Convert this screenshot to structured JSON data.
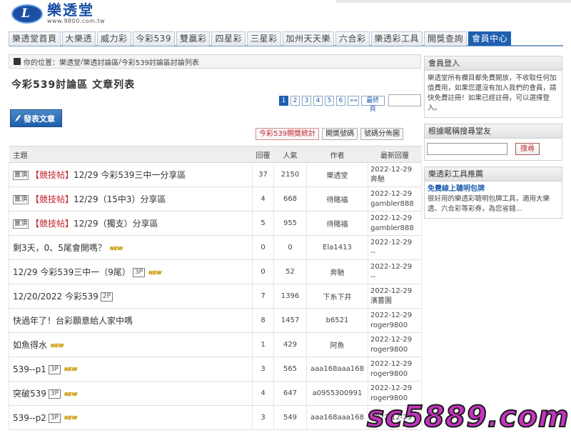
{
  "site": {
    "name": "樂透堂",
    "url": "www.9800.com.tw",
    "logo_letter": "L"
  },
  "nav": [
    "樂透堂首頁",
    "大樂透",
    "威力彩",
    "今彩539",
    "雙贏彩",
    "四星彩",
    "三星彩",
    "加州天天樂",
    "六合彩",
    "樂透彩工具",
    "開獎查詢",
    "會員中心"
  ],
  "breadcrumb": {
    "prefix": "你的位置：",
    "items": [
      "樂透堂",
      "樂透討論區",
      "今彩539討論區討論列表"
    ],
    "separator": " / "
  },
  "page_title": "今彩539討論區 文章列表",
  "pager": {
    "pages": [
      "1",
      "2",
      "3",
      "4",
      "5",
      "6",
      "»»",
      "最終頁"
    ],
    "current": "1"
  },
  "post_button": "發表文章",
  "toolbar": [
    "今彩539開獎統計",
    "開獎號碼",
    "號碼分佈圖"
  ],
  "table": {
    "headers": [
      "主題",
      "回覆",
      "人氣",
      "作者",
      "最新回覆"
    ],
    "rows": [
      {
        "pin": "置頂",
        "flag": "【競技帖】",
        "title": "12/29 今彩539三中一分享區",
        "page": "",
        "new": "",
        "replies": "37",
        "views": "2150",
        "author": "樂透堂",
        "last_date": "2022-12-29",
        "last_user": "奔馳"
      },
      {
        "pin": "置頂",
        "flag": "【競技帖】",
        "title": "12/29（15中3）分享區",
        "page": "",
        "new": "",
        "replies": "4",
        "views": "668",
        "author": "待賭福",
        "last_date": "2022-12-29",
        "last_user": "gambler888"
      },
      {
        "pin": "置頂",
        "flag": "【競技帖】",
        "title": "12/29（獨支）分享區",
        "page": "",
        "new": "",
        "replies": "5",
        "views": "955",
        "author": "待賭福",
        "last_date": "2022-12-29",
        "last_user": "gambler888"
      },
      {
        "pin": "",
        "flag": "",
        "title": "剩3天，0、5尾會開嗎？",
        "page": "",
        "new": "NEW",
        "replies": "0",
        "views": "0",
        "author": "Ela1413",
        "last_date": "2022-12-29",
        "last_user": "--"
      },
      {
        "pin": "",
        "flag": "",
        "title": "12/29 今彩539三中一（9尾）",
        "page": "3P",
        "new": "NEW",
        "replies": "0",
        "views": "52",
        "author": "奔馳",
        "last_date": "2022-12-29",
        "last_user": "--"
      },
      {
        "pin": "",
        "flag": "",
        "title": "12/20/2022 今彩539",
        "page": "2P",
        "new": "",
        "replies": "7",
        "views": "1396",
        "author": "下糸下井",
        "last_date": "2022-12-29",
        "last_user": "濱薔園"
      },
      {
        "pin": "",
        "flag": "",
        "title": "快過年了！台彩願意給人家中嗎",
        "page": "",
        "new": "",
        "replies": "8",
        "views": "1457",
        "author": "b6521",
        "last_date": "2022-12-29",
        "last_user": "roger9800"
      },
      {
        "pin": "",
        "flag": "",
        "title": "如魚得水",
        "page": "",
        "new": "NEW",
        "replies": "1",
        "views": "429",
        "author": "阿魚",
        "last_date": "2022-12-29",
        "last_user": "roger9800"
      },
      {
        "pin": "",
        "flag": "",
        "title": "539--p1",
        "page": "3P",
        "new": "NEW",
        "replies": "3",
        "views": "565",
        "author": "aaa168aaa168",
        "last_date": "2022-12-29",
        "last_user": "roger9800"
      },
      {
        "pin": "",
        "flag": "",
        "title": "突破539",
        "page": "3P",
        "new": "NEW",
        "replies": "4",
        "views": "647",
        "author": "a0955300991",
        "last_date": "2022-12-29",
        "last_user": "roger9800"
      },
      {
        "pin": "",
        "flag": "",
        "title": "539--p2",
        "page": "3P",
        "new": "NEW",
        "replies": "3",
        "views": "549",
        "author": "aaa168aaa168",
        "last_date": "2022-12-29",
        "last_user": ""
      }
    ]
  },
  "sidebar": {
    "login": {
      "title": "會員登入",
      "text": "樂透堂所有欄目都免費開放，不收取任何加值費用，如果您還沒有加入我們的會員，請快免費註冊！如果已經註冊，可以選擇登入。"
    },
    "search": {
      "title": "根據暱稱搜尋堂友",
      "button": "搜尋"
    },
    "tools": {
      "title": "樂透彩工具推薦",
      "link": "免費線上聰明包牌",
      "text": "很好用的樂透彩聰明包牌工具，適用大樂透、六合彩等彩券，為您省錢..."
    }
  },
  "watermark": "sc5889.com"
}
